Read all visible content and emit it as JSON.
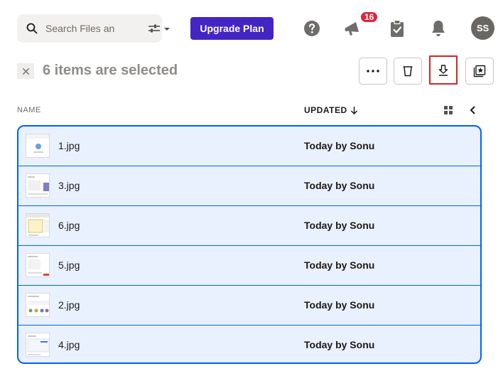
{
  "search": {
    "placeholder": "Search Files an"
  },
  "header": {
    "upgrade_label": "Upgrade Plan",
    "notifications_badge": "16",
    "avatar_initials": "SS"
  },
  "selection": {
    "text": "6 items are selected"
  },
  "columns": {
    "name": "NAME",
    "updated": "UPDATED"
  },
  "files": [
    {
      "name": "1.jpg",
      "updated": "Today by Sonu"
    },
    {
      "name": "3.jpg",
      "updated": "Today by Sonu"
    },
    {
      "name": "6.jpg",
      "updated": "Today by Sonu"
    },
    {
      "name": "5.jpg",
      "updated": "Today by Sonu"
    },
    {
      "name": "2.jpg",
      "updated": "Today by Sonu"
    },
    {
      "name": "4.jpg",
      "updated": "Today by Sonu"
    }
  ],
  "colors": {
    "accent": "#4325c4",
    "selection_border": "#0061fe",
    "selection_bg": "#e9f1ff",
    "badge": "#e0243b",
    "highlight": "#d32525"
  },
  "icons": [
    "search-icon",
    "filter-icon",
    "help-icon",
    "megaphone-icon",
    "clipboard-icon",
    "bell-icon",
    "close-icon",
    "more-icon",
    "delete-icon",
    "download-icon",
    "star-collection-icon",
    "grid-view-icon",
    "chevron-left-icon",
    "sort-down-icon"
  ]
}
